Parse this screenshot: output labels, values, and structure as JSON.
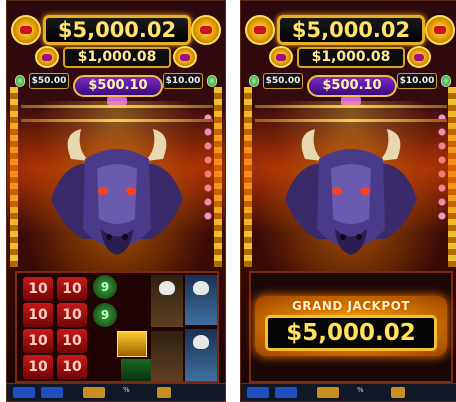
{
  "panels": [
    {
      "top_jackpot": "$5,000.02",
      "second_jackpot": "$1,000.08",
      "mid_jackpot": "$500.10",
      "small_left": "$50.00",
      "small_right": "$10.00",
      "reel_symbols": [
        "10",
        "10",
        "9",
        "9",
        "10",
        "10",
        "10",
        "10",
        "10",
        "10",
        "10"
      ],
      "bottom_symbol": "%"
    },
    {
      "top_jackpot": "$5,000.02",
      "second_jackpot": "$1,000.08",
      "mid_jackpot": "$500.10",
      "small_left": "$50.00",
      "small_right": "$10.00",
      "grand_label": "GRAND JACKPOT",
      "grand_amount": "$5,000.02",
      "bottom_symbol": "%"
    }
  ],
  "colors": {
    "gold": "#f2c030",
    "jackpot_text": "#ffe35a",
    "fire_orange": "#ff7a00",
    "purple": "#7a2ac0"
  },
  "icons": [
    "bull-head-icon",
    "eagle-symbol-icon",
    "gem-icon",
    "coin-icon"
  ]
}
